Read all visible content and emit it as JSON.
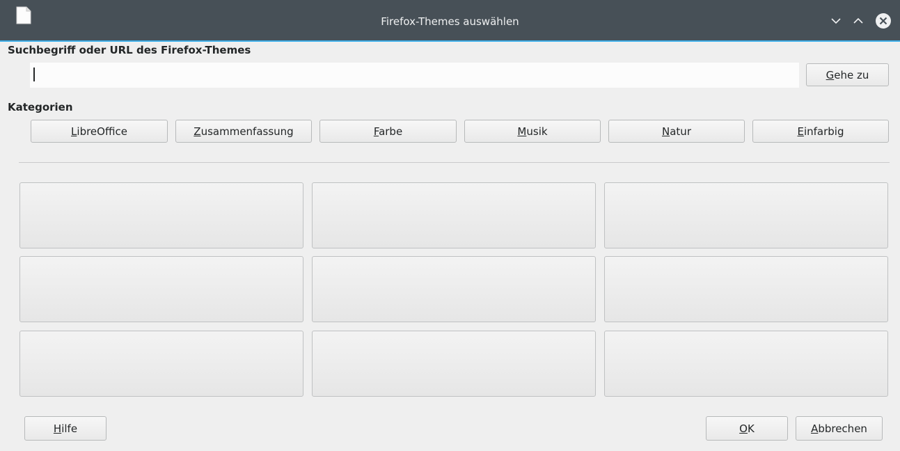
{
  "window": {
    "title": "Firefox-Themes auswählen",
    "accent_color": "#3daee9",
    "titlebar_color": "#475057",
    "icons": [
      "document-icon",
      "minimize-icon",
      "maximize-icon",
      "close-icon"
    ]
  },
  "search": {
    "label": "Suchbegriff oder URL des Firefox-Themes",
    "value": "",
    "go_button": {
      "mnemonic": "G",
      "rest": "ehe zu"
    }
  },
  "categories": {
    "label": "Kategorien",
    "items": [
      {
        "mnemonic": "L",
        "rest": "ibreOffice"
      },
      {
        "mnemonic": "Z",
        "rest": "usammenfassung"
      },
      {
        "mnemonic": "F",
        "rest": "arbe"
      },
      {
        "mnemonic": "M",
        "rest": "usik"
      },
      {
        "mnemonic": "N",
        "rest": "atur"
      },
      {
        "mnemonic": "E",
        "rest": "infarbig"
      }
    ]
  },
  "themes_grid": {
    "rows": 3,
    "columns": 3,
    "tiles": [
      "",
      "",
      "",
      "",
      "",
      "",
      "",
      "",
      ""
    ]
  },
  "footer": {
    "help": {
      "mnemonic": "H",
      "rest": "ilfe"
    },
    "ok": {
      "mnemonic": "O",
      "rest": "K"
    },
    "cancel": {
      "mnemonic": "A",
      "rest": "bbrechen"
    }
  }
}
